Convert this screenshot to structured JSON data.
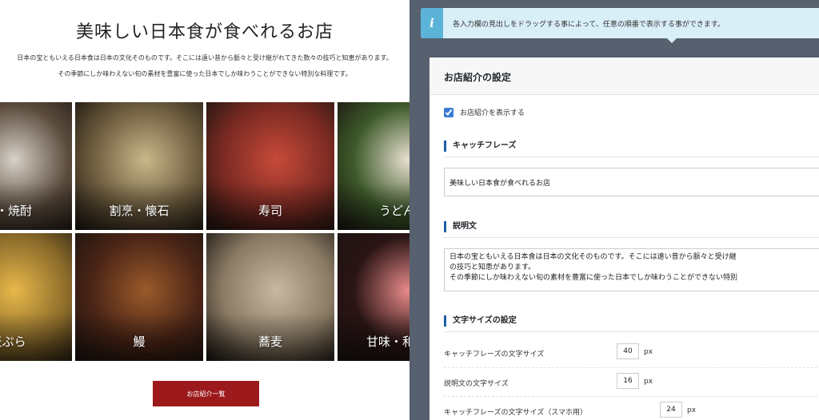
{
  "preview": {
    "catch_phrase": "美味しい日本食が食べれるお店",
    "description_line1": "日本の宝ともいえる日本食は日本の文化そのものです。そこには遠い昔から脈々と受け継がれてきた数々の技巧と知恵があります。",
    "description_line2": "その季節にしか味わえない旬の素材を豊富に使った日本でしか味わうことができない特別な料理です。",
    "tiles": [
      {
        "label": "酒・焼酎",
        "color": "#5a4a3c",
        "accent": "#d8d2c8"
      },
      {
        "label": "割烹・懐石",
        "color": "#6b5a3c",
        "accent": "#c9b88a"
      },
      {
        "label": "寿司",
        "color": "#7a2a22",
        "accent": "#c84a3a"
      },
      {
        "label": "うどん",
        "color": "#3d5a2a",
        "accent": "#e8e0d0"
      },
      {
        "label": "天ぷら",
        "color": "#8a6a2a",
        "accent": "#e8b84a"
      },
      {
        "label": "鰻",
        "color": "#4a2416",
        "accent": "#9a5a2a"
      },
      {
        "label": "蕎麦",
        "color": "#8a7a64",
        "accent": "#c8b8a0"
      },
      {
        "label": "甘味・和菓子",
        "color": "#2a1414",
        "accent": "#e88a8a"
      }
    ],
    "list_button": "お店紹介一覧"
  },
  "admin": {
    "notice": "各入力欄の見出しをドラッグする事によって、任意の順番で表示する事ができます。",
    "panel_title": "お店紹介の設定",
    "show_label": "お店紹介を表示する",
    "show_checked": true,
    "catch_heading": "キャッチフレーズ",
    "catch_value": "美味しい日本食が食べれるお店",
    "desc_heading": "説明文",
    "desc_value": "日本の宝ともいえる日本食は日本の文化そのものです。そこには遠い昔から脈々と受け継\nの技巧と知恵があります。\nその季節にしか味わえない旬の素材を豊富に使った日本でしか味わうことができない特別",
    "font_heading": "文字サイズの設定",
    "sizes": [
      {
        "label": "キャッチフレーズの文字サイズ",
        "value": "40",
        "unit": "px"
      },
      {
        "label": "説明文の文字サイズ",
        "value": "16",
        "unit": "px"
      },
      {
        "label": "キャッチフレーズの文字サイズ（スマホ用）",
        "value": "24",
        "unit": "px"
      }
    ],
    "colors": {
      "notice_bg": "#d9eff8",
      "notice_icon": "#5bb3d8",
      "button": "#9d1a1c",
      "section_bar": "#1f5ea8"
    }
  }
}
